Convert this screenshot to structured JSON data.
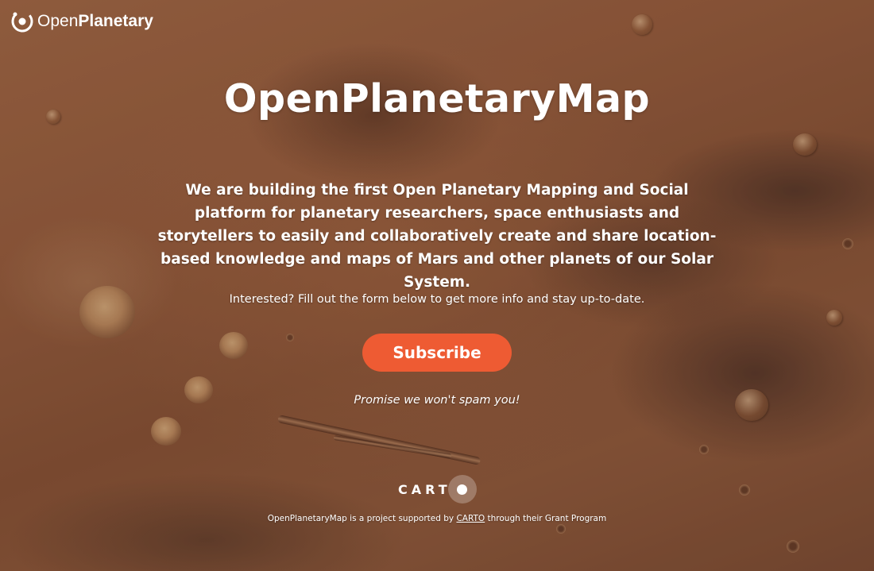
{
  "logo": {
    "text_light": "Open",
    "text_bold": "Planetary",
    "icon": "openplanetary-logo-icon"
  },
  "hero": {
    "title": "OpenPlanetaryMap",
    "intro": "We are building the first Open Planetary Mapping and Social platform for planetary researchers, space enthusiasts and storytellers to easily and collaboratively create and share location-based knowledge and maps of Mars and other planets of our Solar System.",
    "interest": "Interested? Fill out the form below to get more info and stay up-to-date.",
    "subscribe_label": "Subscribe",
    "promise": "Promise we won't spam you!"
  },
  "sponsor": {
    "logo_text": "CART",
    "footer_before": "OpenPlanetaryMap is a project supported by ",
    "footer_link": "CARTO",
    "footer_after": " through their Grant Program"
  },
  "colors": {
    "accent": "#ee5b33",
    "text": "#ffffff"
  }
}
